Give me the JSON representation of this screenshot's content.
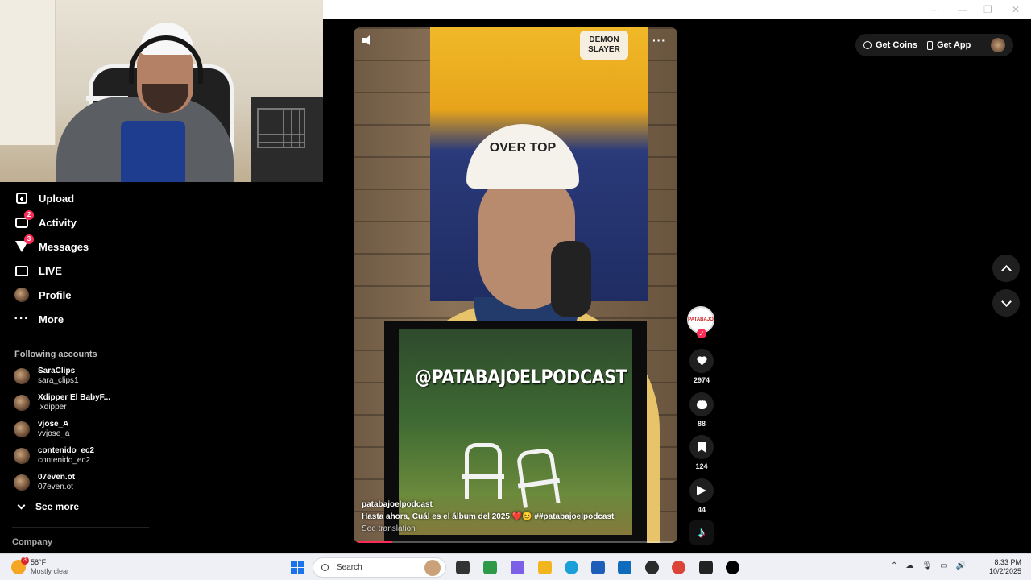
{
  "window": {
    "controls": [
      "···",
      "—",
      "❐",
      "✕"
    ]
  },
  "sidebar": {
    "items": [
      {
        "label": "Upload",
        "icon": "upload-icon",
        "badge": ""
      },
      {
        "label": "Activity",
        "icon": "activity-icon",
        "badge": "2"
      },
      {
        "label": "Messages",
        "icon": "messages-icon",
        "badge": "3"
      },
      {
        "label": "LIVE",
        "icon": "live-icon",
        "badge": ""
      },
      {
        "label": "Profile",
        "icon": "profile-avatar",
        "badge": ""
      },
      {
        "label": "More",
        "icon": "more-icon",
        "badge": ""
      }
    ],
    "following_title": "Following accounts",
    "accounts": [
      {
        "name": "SaraClips",
        "username": "sara_clips1"
      },
      {
        "name": "Xdipper El BabyF...",
        "username": ".xdipper"
      },
      {
        "name": "vjose_A",
        "username": "vvjose_a"
      },
      {
        "name": "contenido_ec2",
        "username": "contenido_ec2"
      },
      {
        "name": "07even.ot",
        "username": "07even.ot"
      }
    ],
    "see_more": "See more",
    "company": "Company"
  },
  "header": {
    "get_coins": "Get Coins",
    "get_app": "Get App"
  },
  "video": {
    "poster_text": "DEMON SLAYER",
    "cap_text": "OVER TOP",
    "overlay_handle": "@PATABAJOELPODCAST",
    "author": "patabajoelpodcast",
    "caption": "Hasta ahora, Cuál es el álbum del 2025 ❤️😊 ##patabajoelpodcast",
    "see_translation": "See translation",
    "progress": 0.12,
    "more": "···"
  },
  "actions": {
    "creator_label": "PATABAJO",
    "follow": "✓",
    "likes": "2974",
    "comments": "88",
    "saves": "124",
    "shares": "44"
  },
  "taskbar": {
    "weather_temp": "58°F",
    "weather_desc": "Mostly clear",
    "weather_badge": "3",
    "search": "Search",
    "time": "8:33 PM",
    "date": "10/2/2025",
    "colors": {
      "start": "#1a73e8",
      "accent": "#fe2c55"
    }
  }
}
